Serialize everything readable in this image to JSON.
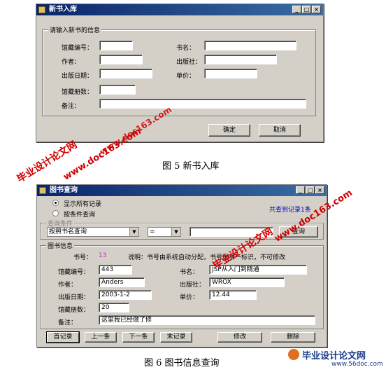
{
  "fig5": {
    "title": "新书入库",
    "group_label": "请输入新书的信息",
    "fields": {
      "id_label": "馆藏编号：",
      "name_label": "书名：",
      "author_label": "作者：",
      "publisher_label": "出版社：",
      "date_label": "出版日期：",
      "price_label": "单价：",
      "count_label": "馆藏册数：",
      "note_label": "备注："
    },
    "ok": "确定",
    "cancel": "取消",
    "caption": "图 5 新书入库"
  },
  "fig6": {
    "title": "图书查询",
    "radio_all": "显示所有记录",
    "radio_cond": "按条件查询",
    "count_text": "共查到记录1条",
    "cond_legend": "查询条件",
    "cond_field": "按照书名查询",
    "cond_op": "=",
    "query_btn": "查询",
    "info_legend": "图书信息",
    "book_no_label": "书号：",
    "book_no": "13",
    "note_desc": "说明：书号由系统自动分配，书号是唯一标识，不可修改",
    "fields": {
      "id_label": "馆藏编号：",
      "id": "443",
      "name_label": "书名：",
      "name": "JSP从入门到精通",
      "author_label": "作者：",
      "author": "Anders",
      "publisher_label": "出版社：",
      "publisher": "WROX",
      "date_label": "出版日期：",
      "date": "2003-1-2",
      "price_label": "单价：",
      "price": "12.44",
      "count_label": "馆藏册数：",
      "count": "20",
      "note_label": "备注：",
      "note": "这里我已经做了修"
    },
    "nav": {
      "first": "首记录",
      "prev": "上一条",
      "next": "下一条",
      "last": "末记录",
      "edit": "修改",
      "delete": "删除"
    },
    "caption": "图 6 图书信息查询"
  },
  "watermarks": {
    "brand": "毕业设计论文网",
    "url": "www.doc163.com",
    "url2": "www.56doc.com"
  }
}
